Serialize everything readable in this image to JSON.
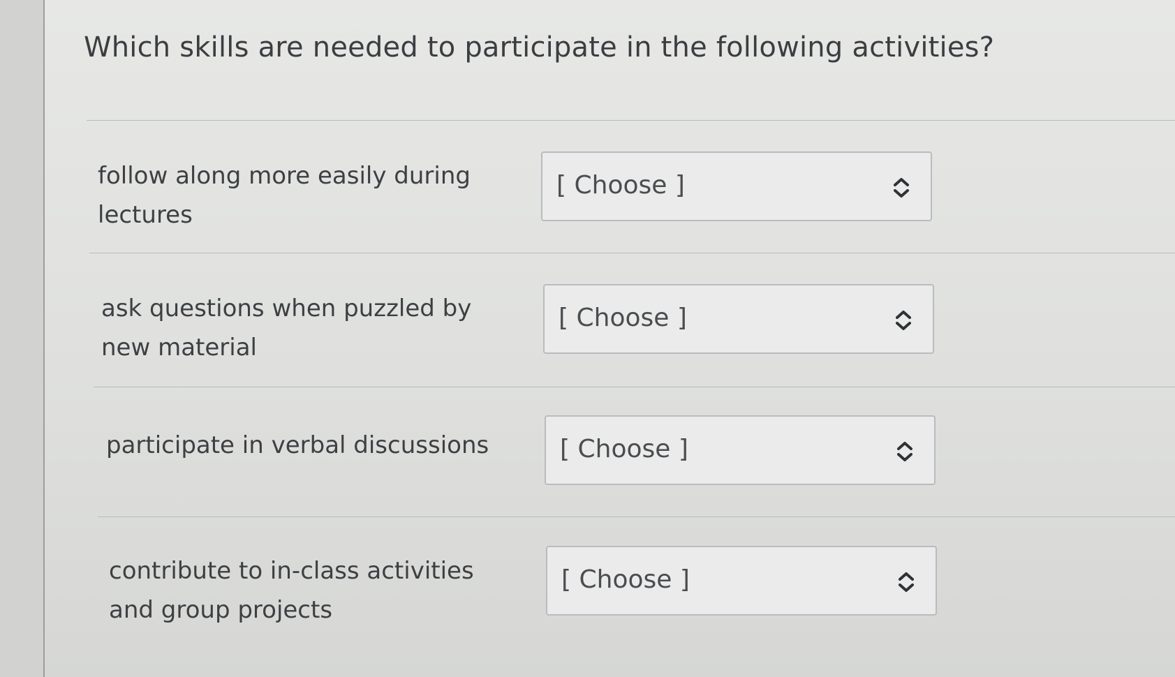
{
  "question": "Which skills are needed to participate in the following activities?",
  "rows": [
    {
      "label": "follow along more easily during lectures",
      "select_value": "[ Choose ]"
    },
    {
      "label": "ask questions when puzzled by new material",
      "select_value": "[ Choose ]"
    },
    {
      "label": "participate in verbal discussions",
      "select_value": "[ Choose ]"
    },
    {
      "label": "contribute to in-class activities and group projects",
      "select_value": "[ Choose ]"
    }
  ],
  "icons": {
    "select_icon": "chevron-up-down-icon"
  },
  "colors": {
    "background": "#dfe0de",
    "text": "#3b3e41",
    "select_border": "#b9bcbf"
  }
}
